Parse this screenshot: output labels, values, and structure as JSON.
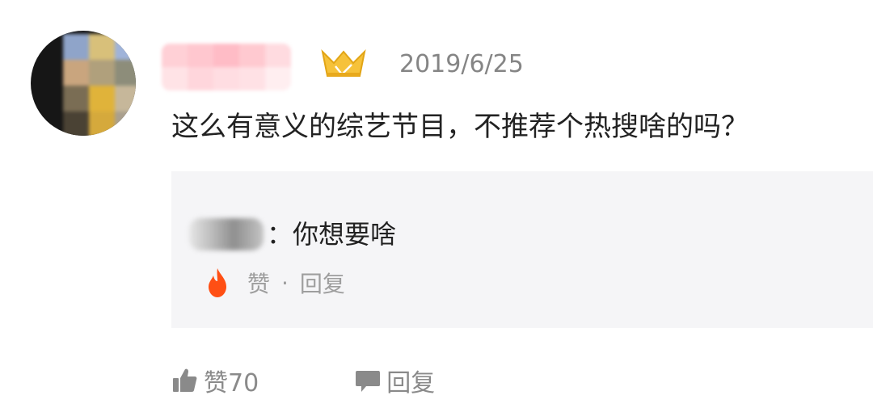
{
  "comment": {
    "date": "2019/6/25",
    "text": "这么有意义的综艺节目，不推荐个热搜啥的吗？",
    "avatar_colors": [
      "#8fa4c9",
      "#d8c07a",
      "#9fb3d9",
      "#c9a57e",
      "#b0a07c",
      "#8d8d7a",
      "#7a6d54",
      "#e0b33a",
      "#c6b79a",
      "#4a4234",
      "#d5a93c",
      "#a99f8e"
    ],
    "username_colors": [
      "#ffd0d6",
      "#ffc7cf",
      "#ffbcc6",
      "#ffc9d0",
      "#ffdbe0",
      "#ffe3e6",
      "#ffd6dc",
      "#ffdde2",
      "#ffe1e5",
      "#ffeef0"
    ]
  },
  "reply": {
    "text": "：你想要啥",
    "like_label": "赞",
    "separator": "·",
    "reply_label": "回复",
    "accent_color": "#ff4f14"
  },
  "actions": {
    "like_label": "赞70",
    "reply_label": "回复"
  },
  "icons": {
    "badge": "vip-crown-icon",
    "reply_like": "flame-icon",
    "like": "thumb-up-icon",
    "reply": "speech-bubble-icon"
  }
}
